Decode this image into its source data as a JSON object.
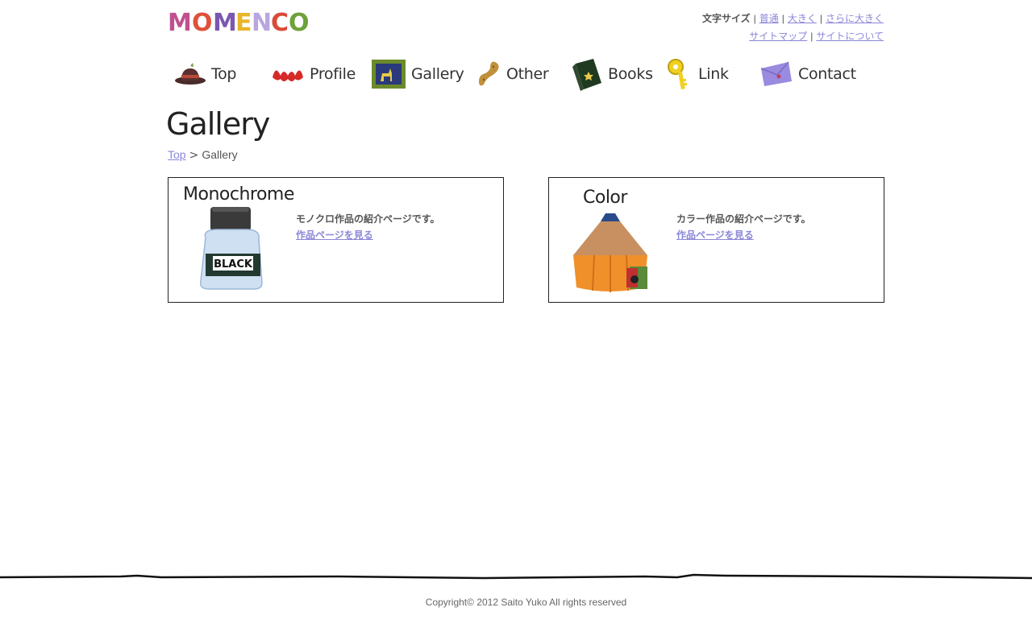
{
  "site": {
    "logo_text": "MOMENCO"
  },
  "utility": {
    "text_size_label": "文字サイズ",
    "size_normal": "普通",
    "size_large": "大きく",
    "size_larger": "さらに大きく",
    "sitemap": "サイトマップ",
    "about": "サイトについて"
  },
  "nav": {
    "items": [
      {
        "label": "Top",
        "icon": "hat-icon"
      },
      {
        "label": "Profile",
        "icon": "moustache-icon"
      },
      {
        "label": "Gallery",
        "icon": "picture-frame-icon"
      },
      {
        "label": "Other",
        "icon": "peanut-icon"
      },
      {
        "label": "Books",
        "icon": "book-icon"
      },
      {
        "label": "Link",
        "icon": "key-icon"
      },
      {
        "label": "Contact",
        "icon": "envelope-icon"
      }
    ]
  },
  "page": {
    "title": "Gallery",
    "breadcrumb": {
      "home": "Top",
      "separator": ">",
      "current": "Gallery"
    }
  },
  "cards": [
    {
      "title": "Monochrome",
      "description": "モノクロ作品の紹介ページです。",
      "link": "作品ページを見る",
      "image_label": "BLACK",
      "icon": "ink-bottle-icon"
    },
    {
      "title": "Color",
      "description": "カラー作品の紹介ページです。",
      "link": "作品ページを見る",
      "icon": "pencil-house-icon"
    }
  ],
  "footer": {
    "copyright": "Copyright© 2012 Saito Yuko All rights reserved"
  },
  "colors": {
    "link": "#8b87d8",
    "text": "#333333",
    "border": "#222222"
  }
}
